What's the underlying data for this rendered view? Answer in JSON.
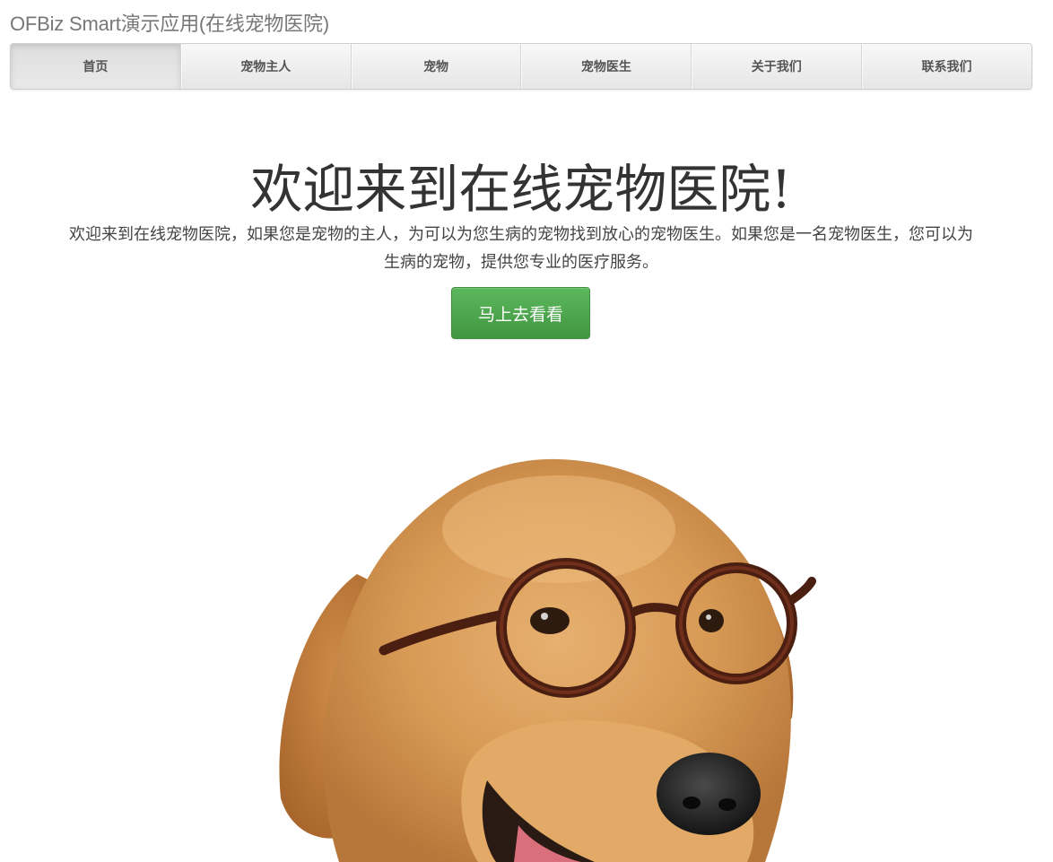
{
  "header": {
    "app_title": "OFBiz Smart演示应用(在线宠物医院)"
  },
  "nav": {
    "items": [
      {
        "label": "首页",
        "active": true
      },
      {
        "label": "宠物主人",
        "active": false
      },
      {
        "label": "宠物",
        "active": false
      },
      {
        "label": "宠物医生",
        "active": false
      },
      {
        "label": "关于我们",
        "active": false
      },
      {
        "label": "联系我们",
        "active": false
      }
    ]
  },
  "hero": {
    "title": "欢迎来到在线宠物医院!",
    "description": "欢迎来到在线宠物医院，如果您是宠物的主人，为可以为您生病的宠物找到放心的宠物医生。如果您是一名宠物医生，您可以为生病的宠物，提供您专业的医疗服务。",
    "cta_label": "马上去看看",
    "image": "dog-with-glasses-photo"
  },
  "colors": {
    "accent_green": "#5cb85c",
    "nav_gradient_top": "#f8f8f8",
    "nav_gradient_bottom": "#e6e6e6",
    "title_gray": "#777777"
  }
}
